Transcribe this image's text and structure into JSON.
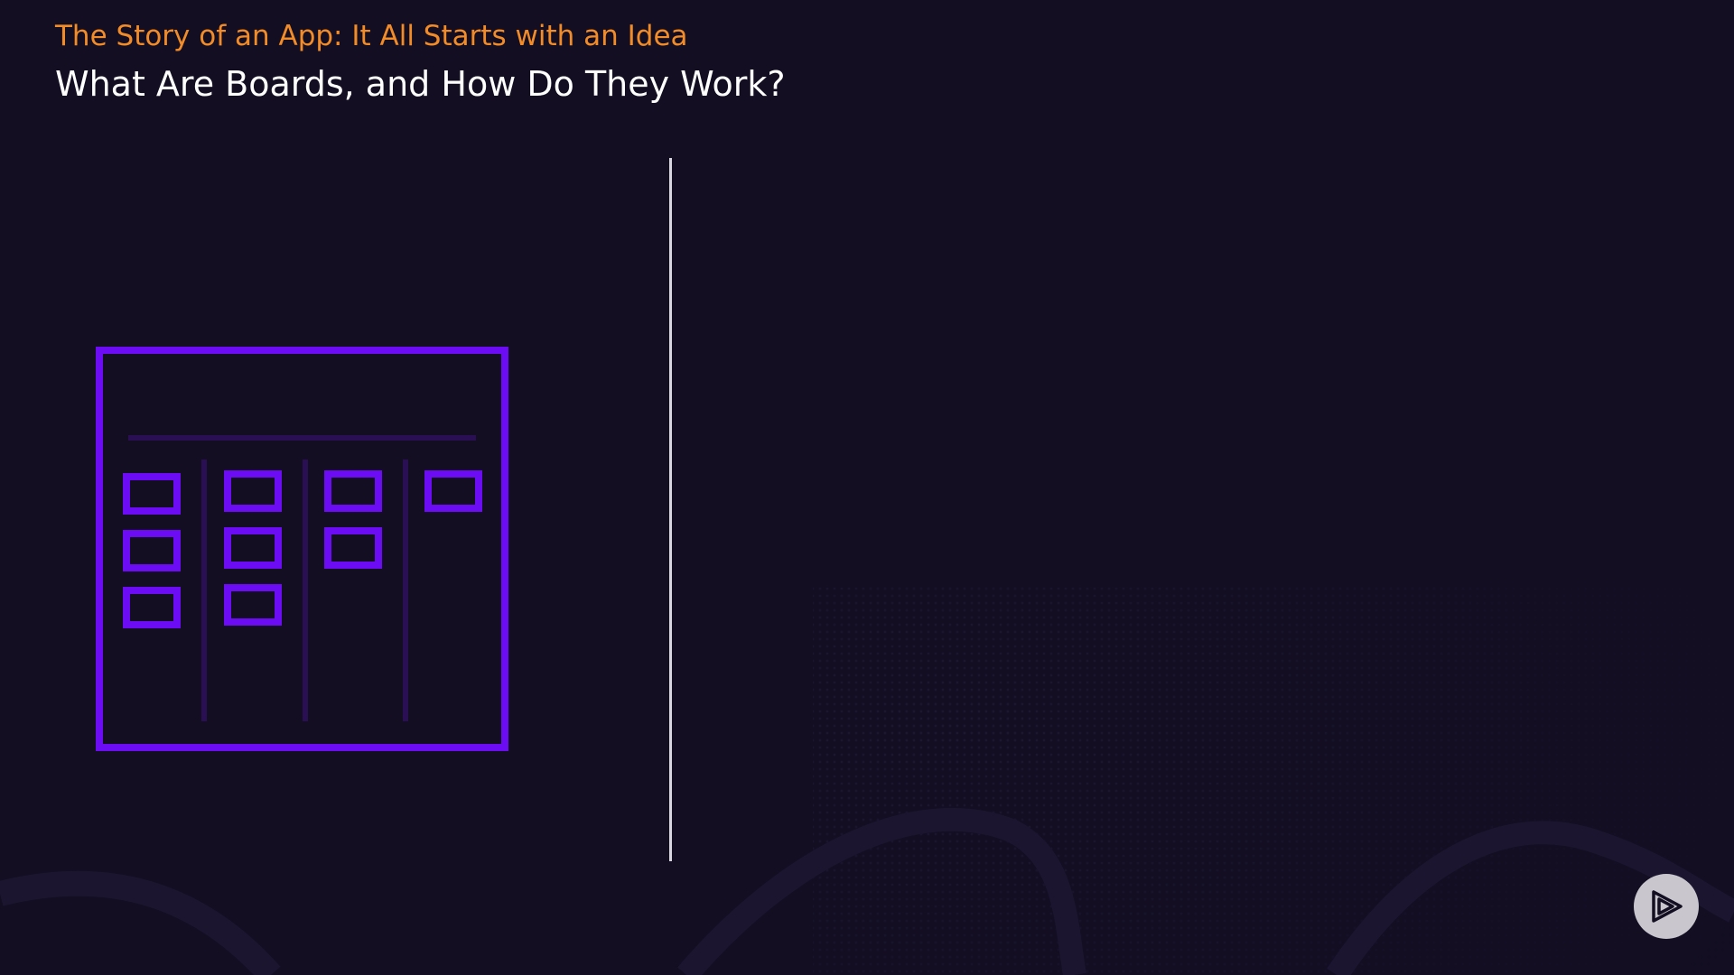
{
  "header": {
    "course_title": "The Story of an App: It All Starts with an Idea",
    "clip_title": "What Are Boards, and How Do They Work?"
  },
  "colors": {
    "background": "#130e22",
    "accent_orange": "#f28c28",
    "title_white": "#ffffff",
    "board_purple": "#6b0cf5",
    "board_dim": "#2a0f55",
    "divider": "#d9d6e0",
    "logo_bg": "#c9c7cd",
    "logo_fg": "#130e22"
  },
  "illustration": {
    "icon": "kanban-board-icon",
    "columns_card_counts": [
      3,
      3,
      2,
      1
    ]
  },
  "logo": {
    "icon": "pluralsight-play-icon"
  }
}
